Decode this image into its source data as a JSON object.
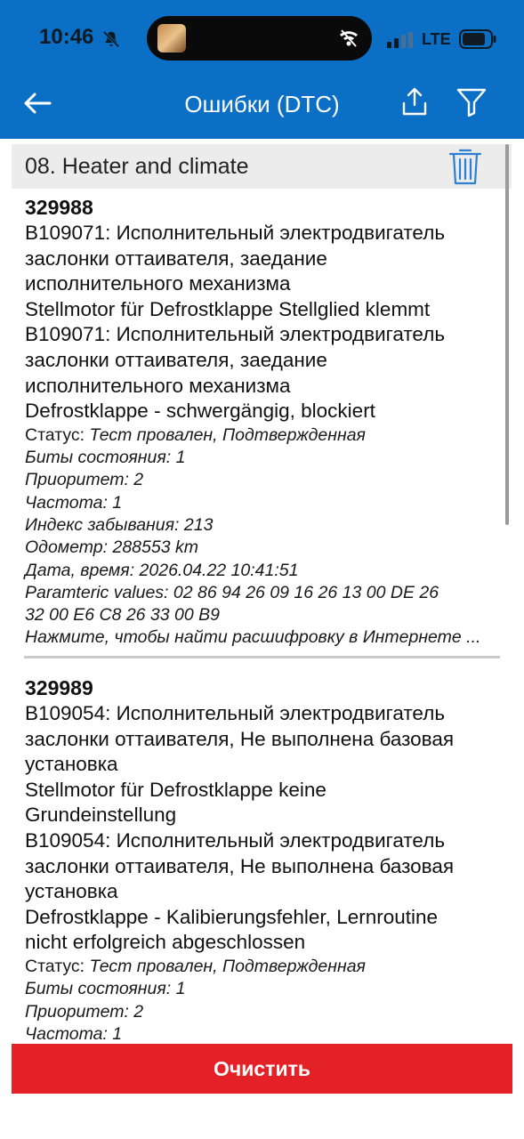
{
  "status_bar": {
    "time": "10:46",
    "network": "LTE"
  },
  "header": {
    "title": "Ошибки (DTC)"
  },
  "section": {
    "title": "08. Heater and climate"
  },
  "dtcs": [
    {
      "code": "329988",
      "lines": [
        "B109071: Исполнительный электродвигатель",
        "заслонки оттаивателя, заедание",
        "исполнительного механизма",
        "Stellmotor für Defrostklappe Stellglied klemmt",
        "B109071: Исполнительный электродвигатель",
        "заслонки оттаивателя, заедание",
        "исполнительного механизма",
        "Defrostklappe - schwergängig, blockiert"
      ],
      "status_label": "Статус:",
      "status_value": "Тест провален, Подтвержденная",
      "meta": [
        "Биты состояния: 1",
        "Приоритет: 2",
        "Частота: 1",
        "Индекс забывания: 213",
        "Одометр: 288553 km",
        "Дата, время: 2026.04.22 10:41:51",
        "Paramteric values:  02 86 94 26 09 16 26 13 00 DE 26",
        "32 00 E6 C8 26 33 00 B9",
        "Нажмите, чтобы найти расшифровку в Интернете ..."
      ]
    },
    {
      "code": "329989",
      "lines": [
        "B109054: Исполнительный электродвигатель",
        "заслонки оттаивателя, Не выполнена базовая",
        "установка",
        "Stellmotor für Defrostklappe keine",
        "Grundeinstellung",
        "B109054: Исполнительный электродвигатель",
        "заслонки оттаивателя, Не выполнена базовая",
        "установка",
        "Defrostklappe - Kalibierungsfehler, Lernroutine",
        "nicht erfolgreich abgeschlossen"
      ],
      "status_label": "Статус:",
      "status_value": "Тест провален, Подтвержденная",
      "meta": [
        "Биты состояния: 1",
        "Приоритет: 2",
        "Частота: 1"
      ]
    }
  ],
  "footer": {
    "clear_label": "Очистить"
  },
  "colors": {
    "header_blue": "#0b70c5",
    "clear_red": "#e32127",
    "section_gray": "#ececec",
    "trash_blue": "#2f7fd0"
  },
  "icons": [
    "bell-slash-icon",
    "wifi-off-icon",
    "signal-icon",
    "battery-icon",
    "back-arrow-icon",
    "share-icon",
    "filter-icon",
    "trash-icon"
  ]
}
